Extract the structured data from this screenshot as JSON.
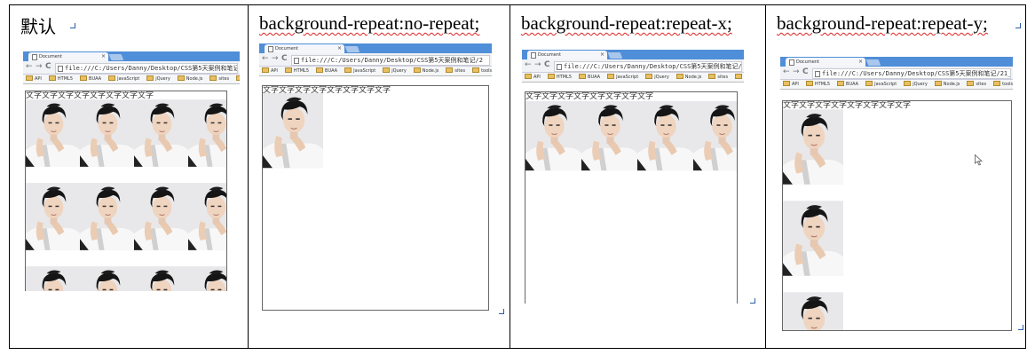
{
  "panels": [
    {
      "title": "默认",
      "browser": {
        "tab_title": "Document",
        "tab_close": "×",
        "address": "file:///C:/Users/Danny/Desktop/CSS第5天案例和笔记/21_",
        "bookmarks": [
          "API",
          "HTML5",
          "BUAA",
          "JavaScript",
          "jQuery",
          "Node.js",
          "sites",
          "tools"
        ],
        "viewport_text": "文字文字文字文字文字文字文字文字"
      },
      "repeat_mode": "repeat"
    },
    {
      "title": "background-repeat:no-repeat;",
      "browser": {
        "tab_title": "Document",
        "tab_close": "×",
        "address": "file:///C:/Users/Danny/Desktop/CSS第5天案例和笔记/2",
        "bookmarks": [
          "API",
          "HTML5",
          "BUAA",
          "JavaScript",
          "jQuery",
          "Node.js",
          "sites",
          "tools"
        ],
        "viewport_text": "文字文字文字文字文字文字文字文字"
      },
      "repeat_mode": "no-repeat"
    },
    {
      "title": "background-repeat:repeat-x;",
      "browser": {
        "tab_title": "Document",
        "tab_close": "×",
        "address": "file:///C:/Users/Danny/Desktop/CSS第5天案例和笔记/2",
        "bookmarks": [
          "API",
          "HTML5",
          "BUAA",
          "JavaScript",
          "jQuery",
          "Node.js",
          "sites",
          "tools"
        ],
        "viewport_text": "文字文字文字文字文字文字文字文字"
      },
      "repeat_mode": "repeat-x"
    },
    {
      "title": "background-repeat:repeat-y;",
      "browser": {
        "tab_title": "Document",
        "tab_close": "×",
        "address": "file:///C:/Users/Danny/Desktop/CSS第5天案例和笔记/21_",
        "bookmarks": [
          "API",
          "HTML5",
          "BUAA",
          "JavaScript",
          "jQuery",
          "Node.js",
          "sites",
          "tools"
        ],
        "viewport_text": "文字文字文字文字文字文字文字文字"
      },
      "repeat_mode": "repeat-y"
    }
  ],
  "colors": {
    "tab_bar": "#4f8ed8",
    "spell_underline": "#d22",
    "paragraph_mark": "#2a5caa"
  },
  "icons": {
    "back": "←",
    "forward": "→",
    "reload": "C"
  }
}
